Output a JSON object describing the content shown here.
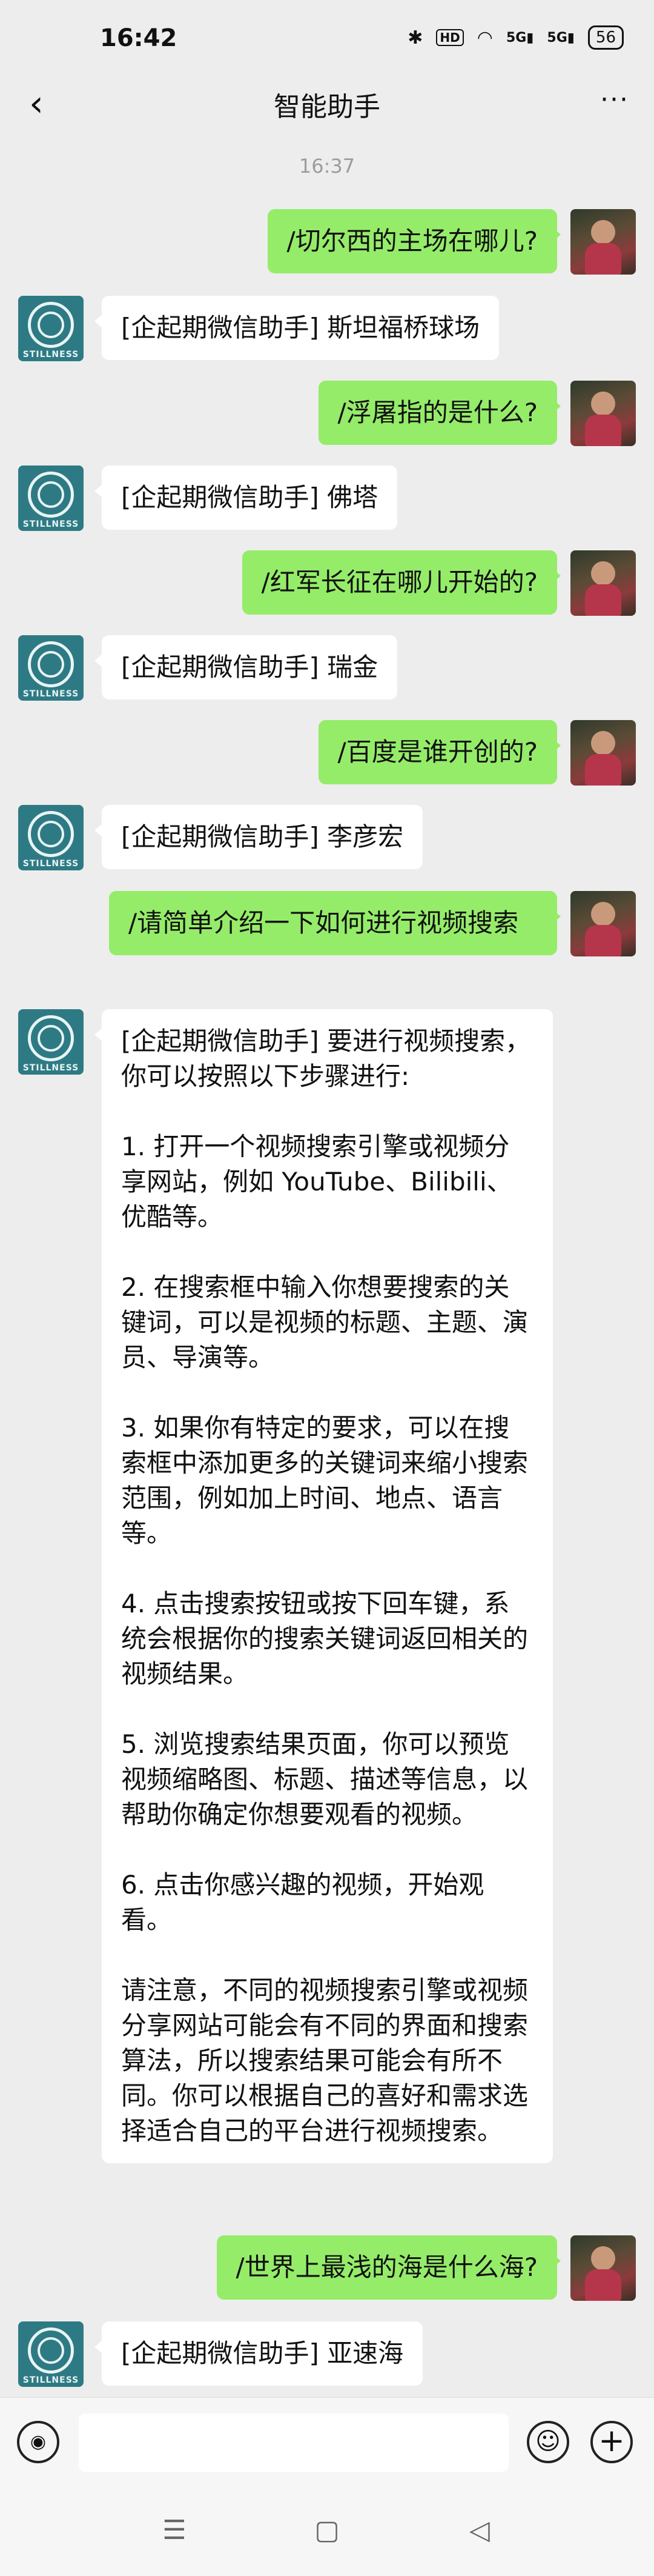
{
  "status_bar": {
    "time": "16:42",
    "icons": [
      "bluetooth-icon",
      "hd-icon",
      "wifi-icon",
      "5g-signal-icon",
      "5g-signal-icon"
    ],
    "icon_glyphs": {
      "bluetooth": "✱",
      "hd": "HD",
      "wifi": "◠",
      "sig1": "5G▮",
      "sig2": "5G▮"
    },
    "battery": "56"
  },
  "nav": {
    "back_glyph": "‹",
    "title": "智能助手",
    "more_glyph": "···"
  },
  "timestamp": "16:37",
  "messages": [
    {
      "from": "user",
      "text": "/切尔西的主场在哪儿?"
    },
    {
      "from": "bot",
      "text": "[企起期微信助手] 斯坦福桥球场"
    },
    {
      "from": "user",
      "text": "/浮屠指的是什么?"
    },
    {
      "from": "bot",
      "text": "[企起期微信助手] 佛塔"
    },
    {
      "from": "user",
      "text": "/红军长征在哪儿开始的?"
    },
    {
      "from": "bot",
      "text": "[企起期微信助手] 瑞金"
    },
    {
      "from": "user",
      "text": "/百度是谁开创的?"
    },
    {
      "from": "bot",
      "text": "[企起期微信助手] 李彦宏"
    },
    {
      "from": "user",
      "text": "/请简单介绍一下如何进行视频搜索"
    },
    {
      "from": "bot",
      "text": "[企起期微信助手] 要进行视频搜索，你可以按照以下步骤进行:\n\n1. 打开一个视频搜索引擎或视频分享网站，例如 YouTube、Bilibili、优酷等。\n\n2. 在搜索框中输入你想要搜索的关键词，可以是视频的标题、主题、演员、导演等。\n\n3. 如果你有特定的要求，可以在搜索框中添加更多的关键词来缩小搜索范围，例如加上时间、地点、语言等。\n\n4. 点击搜索按钮或按下回车键，系统会根据你的搜索关键词返回相关的视频结果。\n\n5. 浏览搜索结果页面，你可以预览视频缩略图、标题、描述等信息，以帮助你确定你想要观看的视频。\n\n6. 点击你感兴趣的视频，开始观看。\n\n请注意，不同的视频搜索引擎或视频分享网站可能会有不同的界面和搜索算法，所以搜索结果可能会有所不同。你可以根据自己的喜好和需求选择适合自己的平台进行视频搜索。"
    },
    {
      "from": "user",
      "text": "/世界上最浅的海是什么海?"
    },
    {
      "from": "bot",
      "text": "[企起期微信助手] 亚速海"
    }
  ],
  "bot_avatar_brand": "STILLNESS",
  "input_bar": {
    "voice_glyph": "◉",
    "input_value": "",
    "emoji_glyph": "☺",
    "plus_glyph": "+"
  },
  "system_nav": {
    "menu_glyph": "☰",
    "home_glyph": "▢",
    "back_glyph": "◁"
  }
}
